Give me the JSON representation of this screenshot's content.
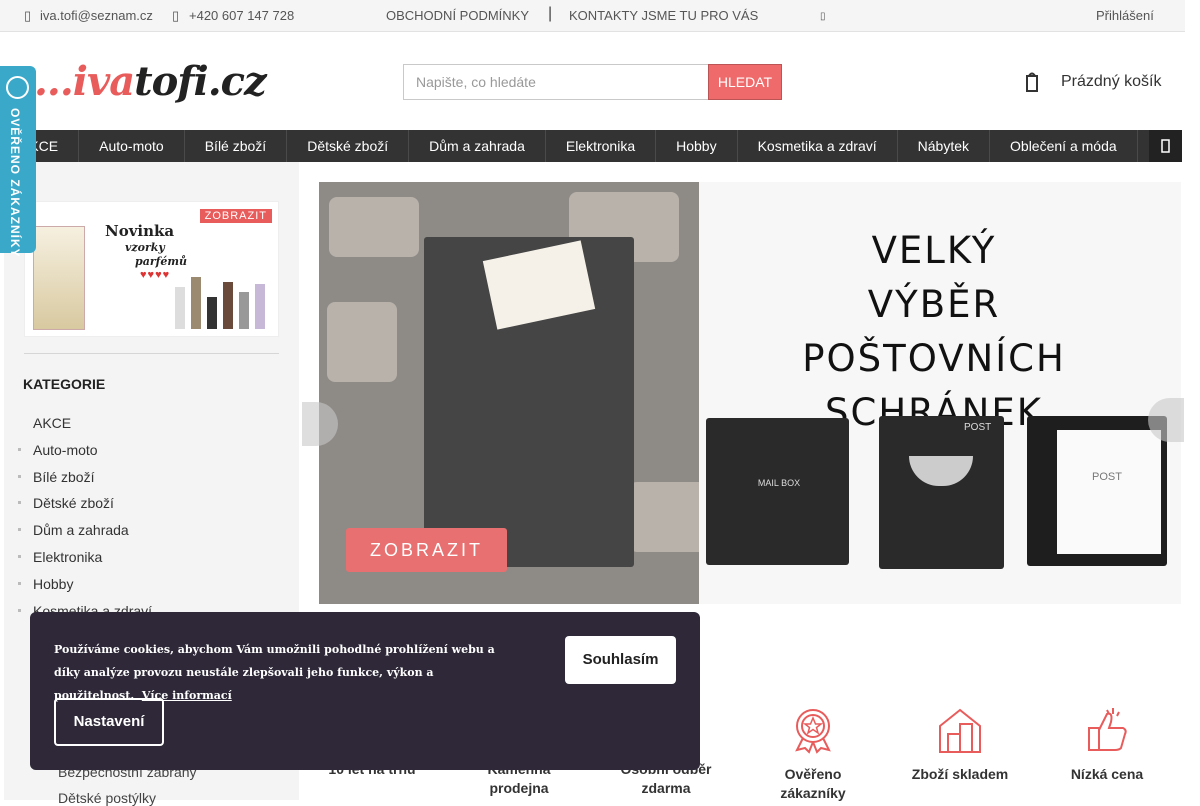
{
  "topbar": {
    "email": "iva.tofi@seznam.cz",
    "phone": "+420 607 147 728",
    "links": [
      "OBCHODNÍ PODMÍNKY",
      "KONTAKTY JSME TU PRO VÁS"
    ],
    "login": "Přihlášení"
  },
  "header": {
    "logo": {
      "dots": "...",
      "iva": "iva",
      "rest": "tofi.cz"
    },
    "search_placeholder": "Napište, co hledáte",
    "search_button": "HLEDAT",
    "cart_label": "Prázdný košík"
  },
  "nav": {
    "items": [
      "AKCE",
      "Auto-moto",
      "Bílé zboží",
      "Dětské zboží",
      "Dům a zahrada",
      "Elektronika",
      "Hobby",
      "Kosmetika a zdraví",
      "Nábytek",
      "Oblečení a móda"
    ]
  },
  "badge": {
    "text": "OVĚŘENO ZÁKAZNÍKY"
  },
  "sidebar": {
    "promo": {
      "button": "ZOBRAZIT",
      "line1": "Novinka",
      "line2": "vzorky",
      "line3": "parfémů"
    },
    "heading": "KATEGORIE",
    "categories": [
      "AKCE",
      "Auto-moto",
      "Bílé zboží",
      "Dětské zboží",
      "Dům a zahrada",
      "Elektronika",
      "Hobby",
      "Kosmetika a zdraví"
    ],
    "subcategories": [
      "Bezpečnostní zábrany",
      "Dětské postýlky"
    ]
  },
  "banner": {
    "headline": [
      "VELKÝ VÝBĚR",
      "POŠTOVNÍCH",
      "SCHRÁNEK"
    ],
    "button": "ZOBRAZIT",
    "mailbox_labels": [
      "MAIL BOX",
      "POST",
      "POST"
    ]
  },
  "features": [
    {
      "label": "10 let na trhu",
      "icon": "calendar-icon"
    },
    {
      "label": "Kamenná prodejna",
      "icon": "store-icon"
    },
    {
      "label": "Osobní odběr zdarma",
      "icon": "pickup-icon"
    },
    {
      "label": "Ověřeno zákazníky",
      "icon": "award-icon"
    },
    {
      "label": "Zboží skladem",
      "icon": "warehouse-icon"
    },
    {
      "label": "Nízká cena",
      "icon": "thumbs-up-icon"
    }
  ],
  "cookie": {
    "text": "Používáme cookies, abychom Vám umožnili pohodlné prohlížení webu a díky analýze provozu neustále zlepšovali jeho funkce, výkon a použitelnost.",
    "more": "Více informací",
    "agree": "Souhlasím",
    "settings": "Nastavení"
  },
  "colors": {
    "accent": "#e85c5c",
    "nav": "#333333",
    "badge": "#3aa9c9",
    "cookie_bg": "#2e2838"
  }
}
